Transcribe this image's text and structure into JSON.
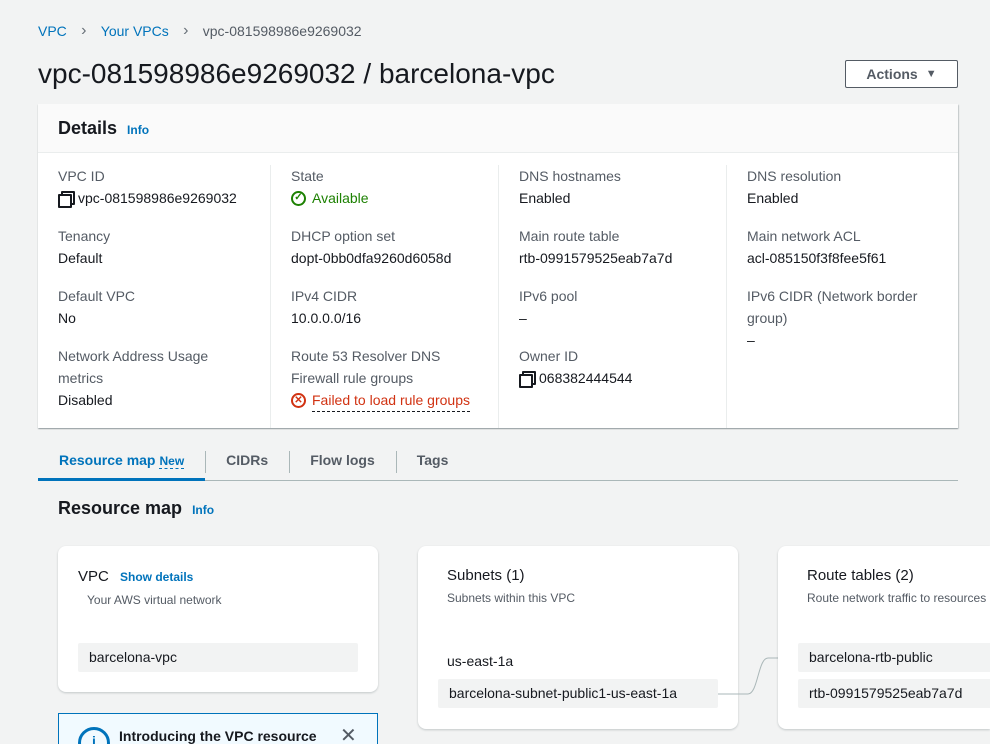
{
  "breadcrumb": {
    "vpc": "VPC",
    "your_vpcs": "Your VPCs",
    "current": "vpc-081598986e9269032"
  },
  "page_title": "vpc-081598986e9269032 / barcelona-vpc",
  "actions": {
    "label": "Actions",
    "caret": "▼"
  },
  "details": {
    "title": "Details",
    "info": "Info",
    "vpc_id_label": "VPC ID",
    "vpc_id": "vpc-081598986e9269032",
    "tenancy_label": "Tenancy",
    "tenancy": "Default",
    "default_vpc_label": "Default VPC",
    "default_vpc": "No",
    "nau_label": "Network Address Usage metrics",
    "nau": "Disabled",
    "state_label": "State",
    "state": "Available",
    "dhcp_label": "DHCP option set",
    "dhcp": "dopt-0bb0dfa9260d6058d",
    "ipv4_label": "IPv4 CIDR",
    "ipv4": "10.0.0.0/16",
    "r53_label": "Route 53 Resolver DNS Firewall rule groups",
    "r53": "Failed to load rule groups",
    "dns_host_label": "DNS hostnames",
    "dns_host": "Enabled",
    "main_rt_label": "Main route table",
    "main_rt": "rtb-0991579525eab7a7d",
    "ipv6_pool_label": "IPv6 pool",
    "ipv6_pool": "–",
    "owner_label": "Owner ID",
    "owner": "068382444544",
    "dns_res_label": "DNS resolution",
    "dns_res": "Enabled",
    "acl_label": "Main network ACL",
    "acl": "acl-085150f3f8fee5f61",
    "ipv6_cidr_label": "IPv6 CIDR (Network border group)",
    "ipv6_cidr": "–"
  },
  "tabs": [
    {
      "label": "Resource map",
      "badge": "New"
    },
    {
      "label": "CIDRs"
    },
    {
      "label": "Flow logs"
    },
    {
      "label": "Tags"
    }
  ],
  "resource_map": {
    "title": "Resource map",
    "info": "Info",
    "vpc_card": {
      "title": "VPC",
      "show_details": "Show details",
      "subtitle": "Your AWS virtual network",
      "item": "barcelona-vpc"
    },
    "subnets_card": {
      "title": "Subnets (1)",
      "subtitle": "Subnets within this VPC",
      "az": "us-east-1a",
      "item": "barcelona-subnet-public1-us-east-1a"
    },
    "rt_card": {
      "title": "Route tables (2)",
      "subtitle": "Route network traffic to resources",
      "items": [
        "barcelona-rtb-public",
        "rtb-0991579525eab7a7d"
      ]
    }
  },
  "banner": {
    "text": "Introducing the VPC resource",
    "icon": "i",
    "close": "✕"
  },
  "colors": {
    "link": "#0073bb",
    "success": "#1d8102",
    "error": "#d13212"
  }
}
